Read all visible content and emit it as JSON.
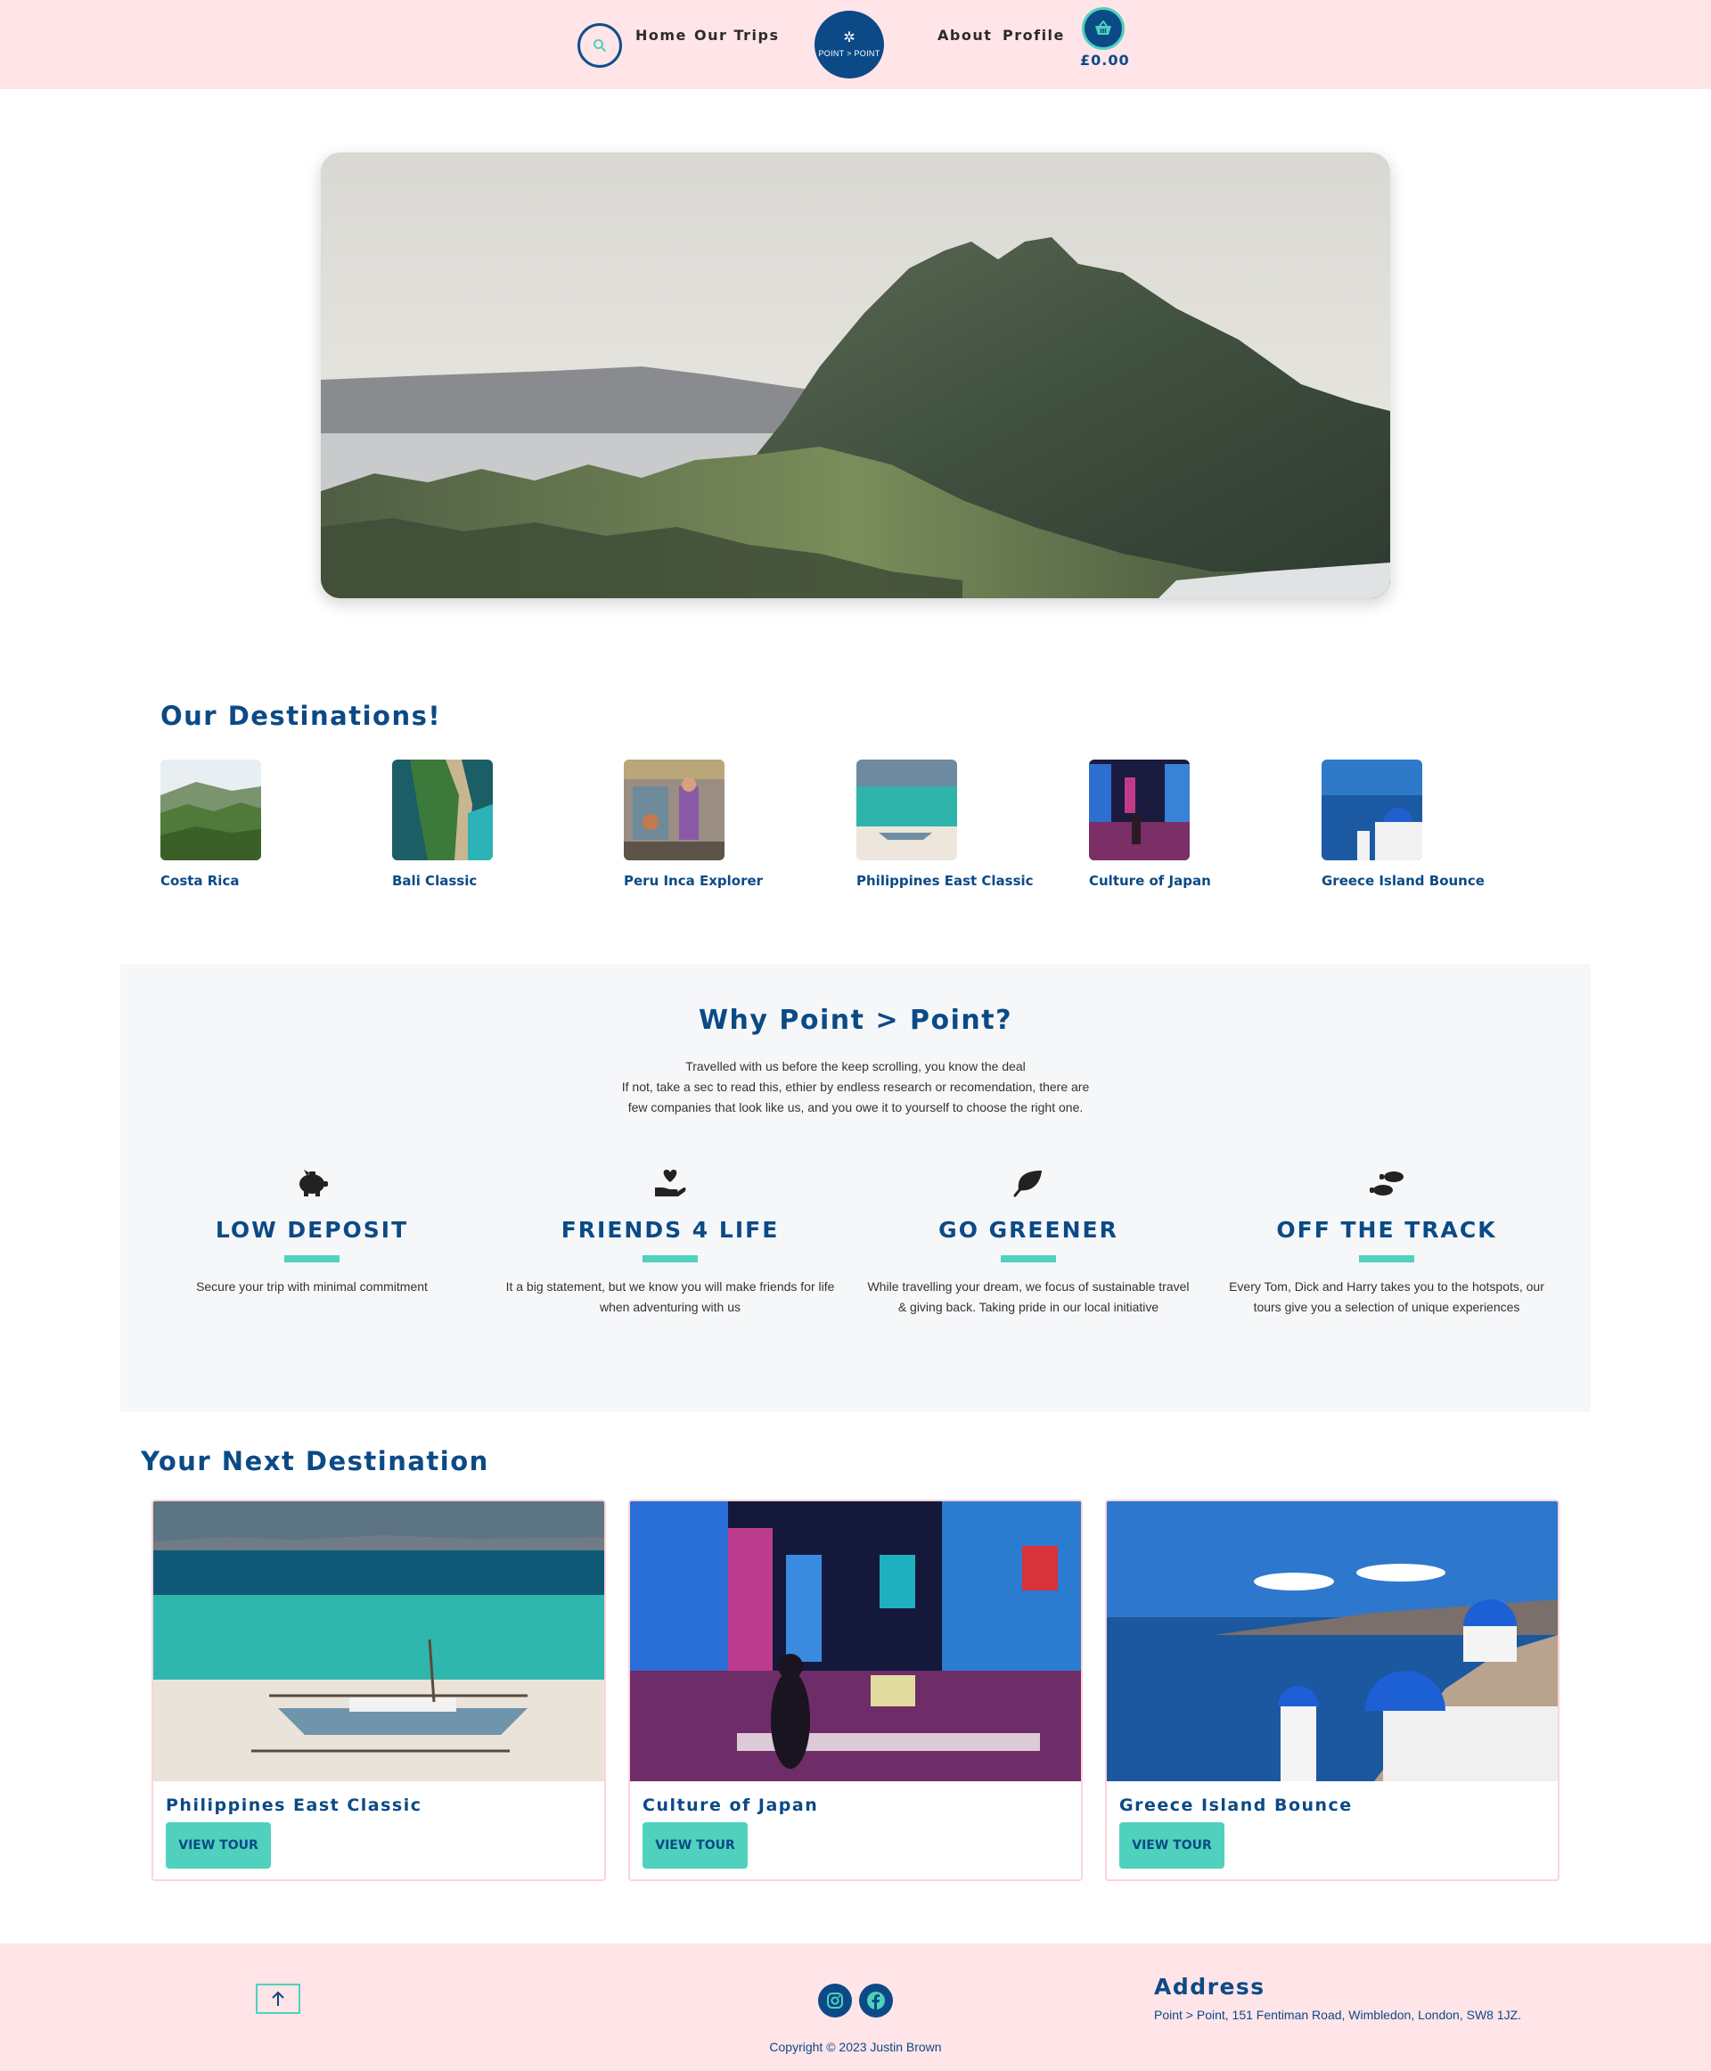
{
  "nav": {
    "links": [
      "Home",
      "Our Trips",
      "About",
      "Profile"
    ],
    "logo_text": "POINT > POINT",
    "cart_total": "£0.00"
  },
  "destinations": {
    "title": "Our Destinations!",
    "items": [
      {
        "name": "Costa Rica"
      },
      {
        "name": "Bali Classic"
      },
      {
        "name": "Peru Inca Explorer"
      },
      {
        "name": "Philippines East Classic"
      },
      {
        "name": "Culture of Japan"
      },
      {
        "name": "Greece Island Bounce"
      }
    ]
  },
  "why": {
    "title": "Why Point > Point?",
    "intro": [
      "Travelled with us before the keep scrolling, you know the deal",
      "If not, take a sec to read this, ethier by endless research or recomendation, there are",
      "few companies that look like us, and you owe it to yourself to choose the right one."
    ],
    "features": [
      {
        "icon": "piggy-bank-icon",
        "title": "LOW DEPOSIT",
        "desc": "Secure your trip with minimal commitment"
      },
      {
        "icon": "hand-holding-heart-icon",
        "title": "FRIENDS 4 LIFE",
        "desc": "It a big statement, but we know you will make friends for life when adventuring with us"
      },
      {
        "icon": "leaf-icon",
        "title": "GO GREENER",
        "desc": "While travelling your dream, we focus of sustainable travel & giving back. Taking pride in our local initiative"
      },
      {
        "icon": "footprints-icon",
        "title": "OFF THE TRACK",
        "desc": "Every Tom, Dick and Harry takes you to the hotspots, our tours give you a selection of unique experiences"
      }
    ]
  },
  "next": {
    "title": "Your Next Destination",
    "cards": [
      {
        "title": "Philippines East Classic",
        "button": "VIEW TOUR"
      },
      {
        "title": "Culture of Japan",
        "button": "VIEW TOUR"
      },
      {
        "title": "Greece Island Bounce",
        "button": "VIEW TOUR"
      }
    ]
  },
  "footer": {
    "address_title": "Address",
    "address": "Point > Point, 151 Fentiman Road, Wimbledon, London, SW8 1JZ.",
    "copyright": "Copyright © 2023 Justin Brown"
  },
  "colors": {
    "nav_bg": "#ffe4e8",
    "brand_blue": "#0b4a86",
    "accent_teal": "#4fd1bd",
    "section_bg": "#f6f7f9"
  }
}
